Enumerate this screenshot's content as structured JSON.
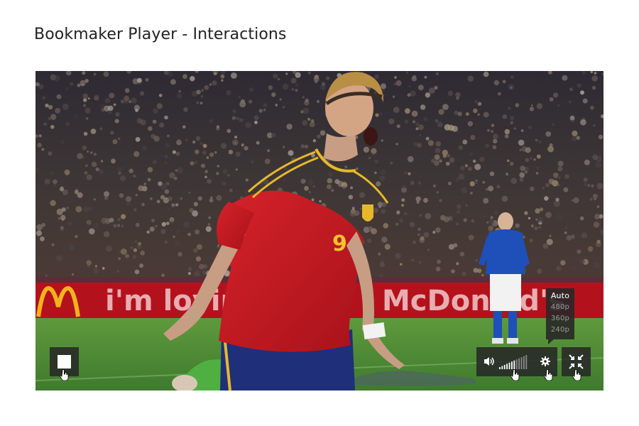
{
  "page": {
    "title": "Bookmaker Player - Interactions"
  },
  "video": {
    "scene": "football-celebration",
    "shirt_number": "9",
    "banner_left": "i'm lovin' it",
    "banner_right": "McDonald's"
  },
  "controls": {
    "stop_icon": "stop-icon",
    "volume_icon": "speaker-icon",
    "volume_level": 0.55,
    "volume_bar_count": 12,
    "settings_icon": "gear-icon",
    "fullscreen_icon": "fullscreen-exit-icon",
    "quality": {
      "options": [
        "Auto",
        "480p",
        "360p",
        "240p"
      ],
      "selected": "Auto"
    }
  },
  "colors": {
    "control_bg": "#282828",
    "control_fg": "#ffffff",
    "menu_inactive_text": "#9a9a9a",
    "jersey_red": "#c8161e",
    "banner_red": "#b3121c",
    "pitch_green": "#4f8a35"
  }
}
